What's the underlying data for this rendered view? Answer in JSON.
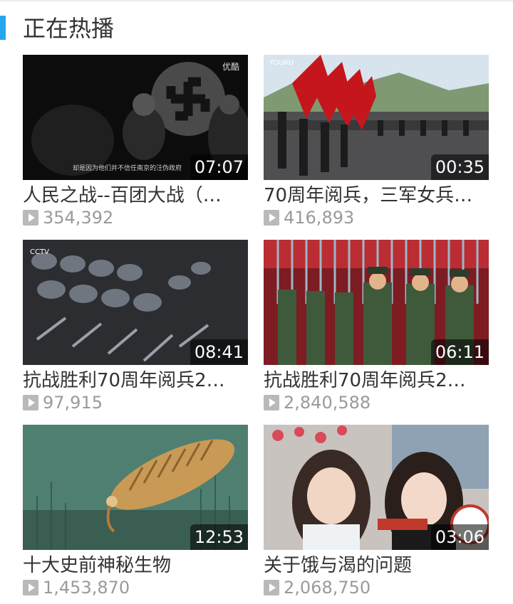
{
  "section": {
    "title": "正在热播"
  },
  "videos": [
    {
      "title": "人民之战--百团大战（…",
      "duration": "07:07",
      "views": "354,392",
      "thumb_icon": "swastika-film-thumbnail",
      "subtitle": "却是因为他们并不信任南京的汪伪政府",
      "logo": "优酷"
    },
    {
      "title": "70周年阅兵，三军女兵…",
      "duration": "00:35",
      "views": "416,893",
      "thumb_icon": "flag-parade-thumbnail",
      "logo": "YOUKU"
    },
    {
      "title": "抗战胜利70周年阅兵2…",
      "duration": "08:41",
      "views": "97,915",
      "thumb_icon": "marching-soldiers-thumbnail",
      "logo": "CCTV"
    },
    {
      "title": "抗战胜利70周年阅兵2…",
      "duration": "06:11",
      "views": "2,840,588",
      "thumb_icon": "honor-guard-thumbnail"
    },
    {
      "title": "十大史前神秘生物",
      "duration": "12:53",
      "views": "1,453,870",
      "thumb_icon": "prehistoric-creature-thumbnail"
    },
    {
      "title": "关于饿与渴的问题",
      "duration": "03:06",
      "views": "2,068,750",
      "thumb_icon": "street-interview-thumbnail"
    }
  ],
  "colors": {
    "accent": "#27a6f0",
    "title_text": "#333333",
    "meta_text": "#9a9a9a"
  }
}
